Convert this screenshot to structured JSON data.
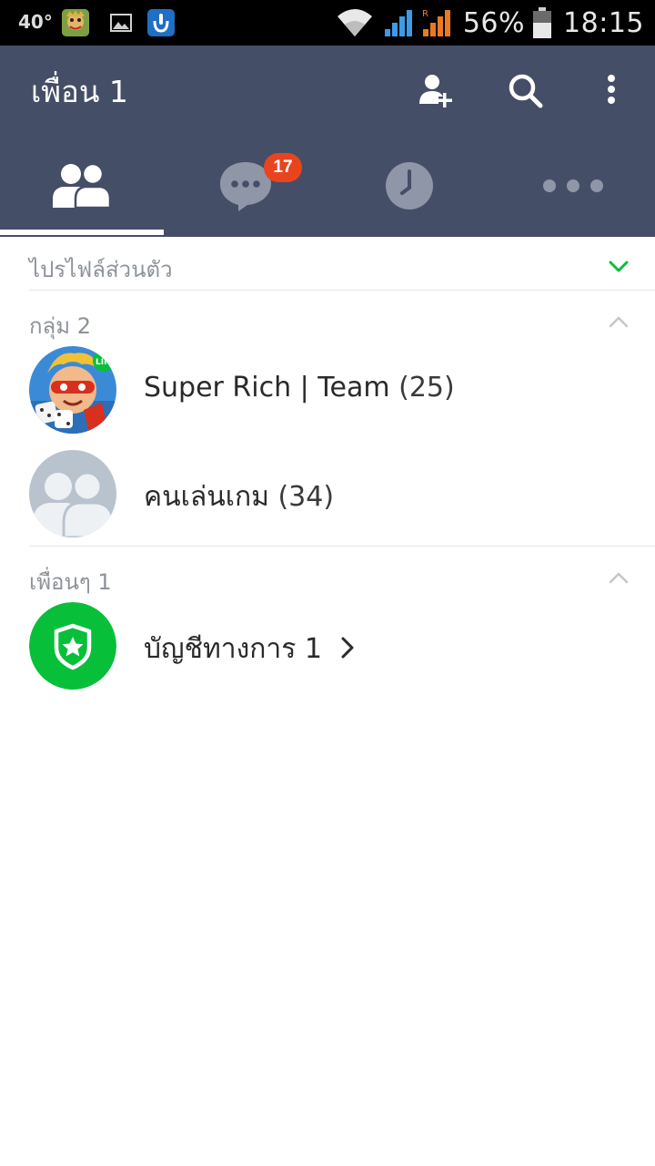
{
  "status_bar": {
    "temperature": "40°",
    "battery_percent": "56%",
    "battery_level": 0.56,
    "time": "18:15"
  },
  "header": {
    "title": "เพื่อน 1",
    "icons": [
      "add-friend-icon",
      "search-icon",
      "more-vertical-icon"
    ]
  },
  "tabs": [
    {
      "name": "friends",
      "icon": "friends-icon",
      "active": true
    },
    {
      "name": "chats",
      "icon": "chat-bubble-icon",
      "badge": "17"
    },
    {
      "name": "timeline",
      "icon": "clock-icon"
    },
    {
      "name": "more",
      "icon": "more-horizontal-icon"
    }
  ],
  "sections": {
    "profile": {
      "label": "ไปรไฟล์ส่วนตัว"
    },
    "groups": {
      "label": "กลุ่ม 2",
      "items": [
        {
          "name": "Super Rich | Team",
          "count": "(25)"
        },
        {
          "name": "คนเล่นเกม",
          "count": "(34)"
        }
      ]
    },
    "friends": {
      "label": "เพื่อนๆ 1",
      "items": [
        {
          "name": "บัญชีทางการ 1"
        }
      ]
    }
  },
  "colors": {
    "header_bg": "#454e67",
    "badge": "#e9441e",
    "accent_green": "#08bf3a",
    "icon_muted": "#8f96a8"
  }
}
